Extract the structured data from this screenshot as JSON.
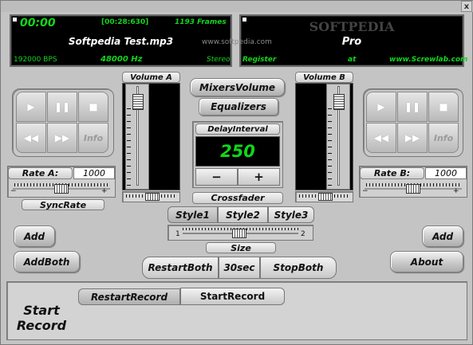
{
  "window": {
    "close_label": "x"
  },
  "deck_a": {
    "time": "00:00",
    "time_total": "[00:28:630]",
    "frames": "1193 Frames",
    "filename": "Softpedia Test.mp3",
    "bitrate": "192000 BPS",
    "samplerate": "48000 Hz",
    "channels": "Stereo",
    "volume_label": "Volume A",
    "rate_label": "Rate A:",
    "rate_value": "1000",
    "info_label": "Info",
    "syncrate_label": "SyncRate",
    "add_label": "Add",
    "addboth_label": "AddBoth",
    "volume_level": 0.92,
    "rate_position": 0.5
  },
  "deck_b": {
    "title": "Pro",
    "register": "Register",
    "at": "at",
    "site": "www.Screwlab.com",
    "volume_label": "Volume B",
    "rate_label": "Rate B:",
    "rate_value": "1000",
    "info_label": "Info",
    "add_label": "Add",
    "about_label": "About",
    "volume_level": 0.92,
    "rate_position": 0.5
  },
  "watermark": {
    "brand": "SOFTPEDIA",
    "url": "www.softpedia.com"
  },
  "center": {
    "mixers_volume": "MixersVolume",
    "equalizers": "Equalizers",
    "delay_label": "DelayInterval",
    "delay_value": "250",
    "minus": "−",
    "plus": "+",
    "crossfader": "Crossfader",
    "crossfader_position": 0.5
  },
  "styles": {
    "items": [
      "Style1",
      "Style2",
      "Style3"
    ],
    "selected": "Style1"
  },
  "size": {
    "label": "Size",
    "min": "1",
    "max": "2",
    "position": 0.5
  },
  "transport": {
    "restart_both": "RestartBoth",
    "sec30": "30sec",
    "stop_both": "StopBoth"
  },
  "record": {
    "title_line1": "Start",
    "title_line2": "Record",
    "restart_record": "RestartRecord",
    "start_record": "StartRecord"
  },
  "icons": [
    "play-icon",
    "pause-icon",
    "stop-icon",
    "rewind-icon",
    "fast-forward-icon"
  ],
  "colors": {
    "lcd_green": "#11d61b",
    "lcd_bg": "#000000",
    "panel": "#c4c4c4"
  }
}
